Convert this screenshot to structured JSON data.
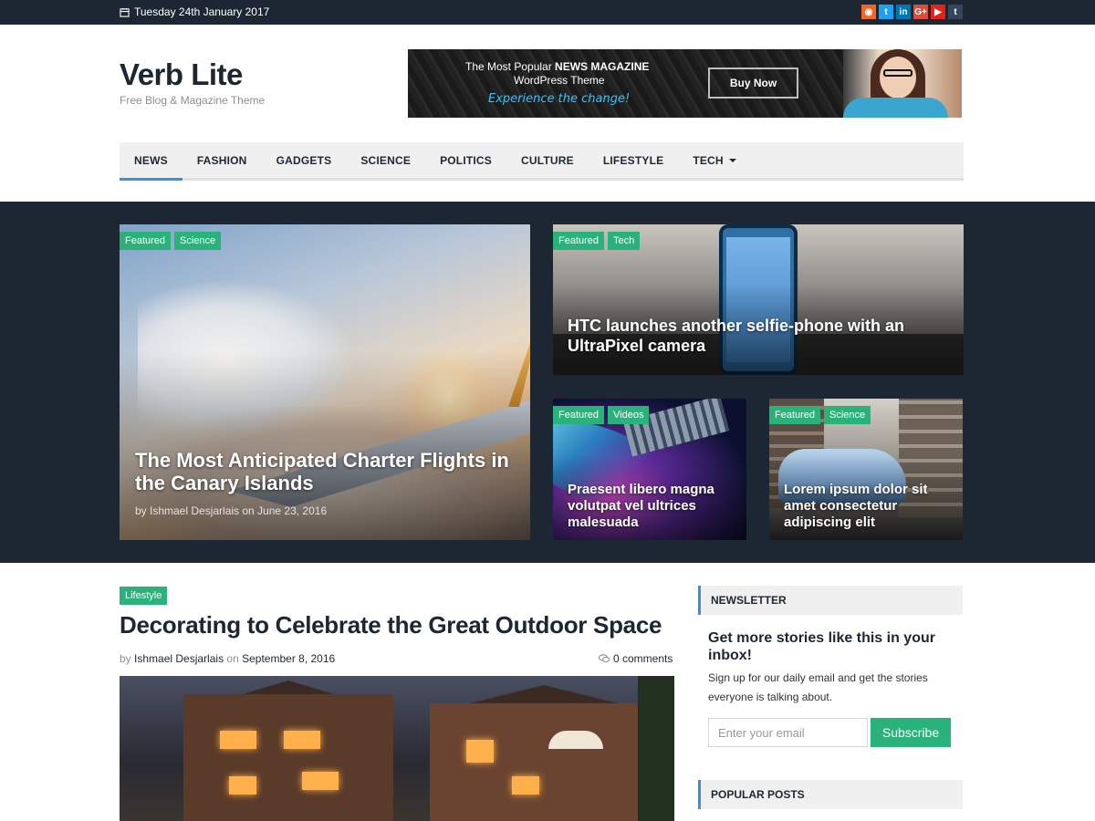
{
  "topbar": {
    "date": "Tuesday 24th January 2017",
    "socials": [
      {
        "icon": "rss-icon",
        "glyph": "◉",
        "color": "#f26522"
      },
      {
        "icon": "twitter-icon",
        "glyph": "t",
        "color": "#1da1f2"
      },
      {
        "icon": "linkedin-icon",
        "glyph": "in",
        "color": "#0077b5"
      },
      {
        "icon": "googleplus-icon",
        "glyph": "G+",
        "color": "#dd4b39"
      },
      {
        "icon": "youtube-icon",
        "glyph": "▶",
        "color": "#e62117"
      },
      {
        "icon": "tumblr-icon",
        "glyph": "t",
        "color": "#35465c"
      }
    ]
  },
  "brand": {
    "title": "Verb Lite",
    "tagline": "Free Blog & Magazine Theme"
  },
  "banner": {
    "line1_prefix": "The Most Popular ",
    "line1_bold": "NEWS MAGAZINE",
    "line2": "WordPress Theme",
    "line3": "Experience the change!",
    "button": "Buy Now"
  },
  "nav": {
    "items": [
      "NEWS",
      "FASHION",
      "GADGETS",
      "SCIENCE",
      "POLITICS",
      "CULTURE",
      "LIFESTYLE",
      "TECH"
    ]
  },
  "featured": {
    "cards": [
      {
        "tags": [
          "Featured",
          "Science"
        ],
        "title": "The Most Anticipated Charter Flights in the Canary Islands",
        "meta": "by Ishmael Desjarlais on June 23, 2016"
      },
      {
        "tags": [
          "Featured",
          "Tech"
        ],
        "title": "HTC launches another selfie-phone with an UltraPixel camera"
      },
      {
        "tags": [
          "Featured",
          "Videos"
        ],
        "title": "Praesent libero magna volutpat vel ultrices malesuada"
      },
      {
        "tags": [
          "Featured",
          "Science"
        ],
        "title": "Lorem ipsum dolor sit amet consectetur adipiscing elit"
      }
    ]
  },
  "post": {
    "tag": "Lifestyle",
    "title": "Decorating to Celebrate the Great Outdoor Space",
    "by": "by",
    "author": "Ishmael Desjarlais",
    "on": "on",
    "date": "September 8, 2016",
    "comments": "0 comments"
  },
  "sidebar": {
    "newsletter": {
      "heading": "NEWSLETTER",
      "title": "Get more stories like this in your inbox!",
      "text": "Sign up for our daily email and get the stories everyone is talking about.",
      "placeholder": "Enter your email",
      "button": "Subscribe"
    },
    "popular_heading": "POPULAR POSTS"
  },
  "colors": {
    "dark": "#1d2733",
    "accent_green": "#2ab27b",
    "accent_blue": "#3a8fd8"
  }
}
